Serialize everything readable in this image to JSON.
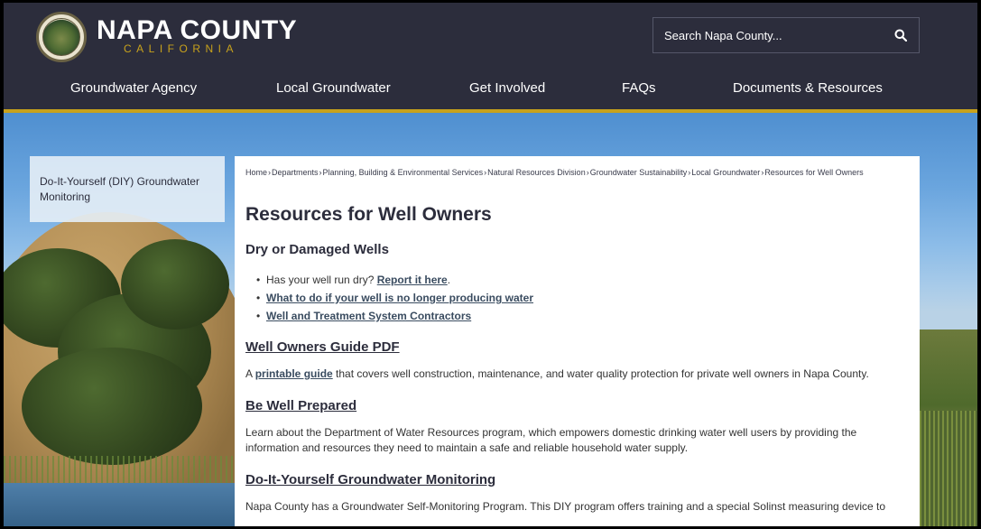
{
  "header": {
    "logo_title": "NAPA COUNTY",
    "logo_sub": "CALIFORNIA",
    "search_placeholder": "Search Napa County...",
    "search_icon": "search-icon"
  },
  "nav": {
    "items": [
      {
        "label": "Groundwater Agency"
      },
      {
        "label": "Local Groundwater"
      },
      {
        "label": "Get Involved"
      },
      {
        "label": "FAQs"
      },
      {
        "label": "Documents & Resources"
      }
    ]
  },
  "sidebar": {
    "link_label": "Do-It-Yourself (DIY) Groundwater Monitoring"
  },
  "breadcrumb": {
    "items": [
      "Home",
      "Departments",
      "Planning, Building & Environmental Services",
      "Natural Resources Division",
      "Groundwater Sustainability",
      "Local Groundwater",
      "Resources for Well Owners"
    ],
    "separator": "›"
  },
  "main": {
    "title": "Resources for Well Owners",
    "dry_heading": "Dry or Damaged Wells",
    "bullet1_text": "Has your well run dry? ",
    "bullet1_link": "Report it here",
    "bullet1_end": ".",
    "bullet2_link": "What to do if your well is no longer producing water",
    "bullet3_link": "Well and Treatment System Contractors",
    "guide_heading": "Well Owners Guide PDF",
    "guide_pre": "A ",
    "guide_link": "printable guide",
    "guide_post": " that covers well construction, maintenance, and water quality protection for private well owners in Napa County.",
    "prepared_heading": "Be Well Prepared",
    "prepared_text": "Learn about the Department of Water Resources program, which empowers domestic drinking water well users by providing the information and resources they need to maintain a safe and reliable household water supply.",
    "diy_heading": "Do-It-Yourself Groundwater Monitoring",
    "diy_text": "Napa County has a Groundwater Self-Monitoring Program. This DIY program offers training and a special Solinst measuring device to"
  },
  "colors": {
    "header_bg": "#2c2d3c",
    "accent_gold": "#c8a21c"
  }
}
